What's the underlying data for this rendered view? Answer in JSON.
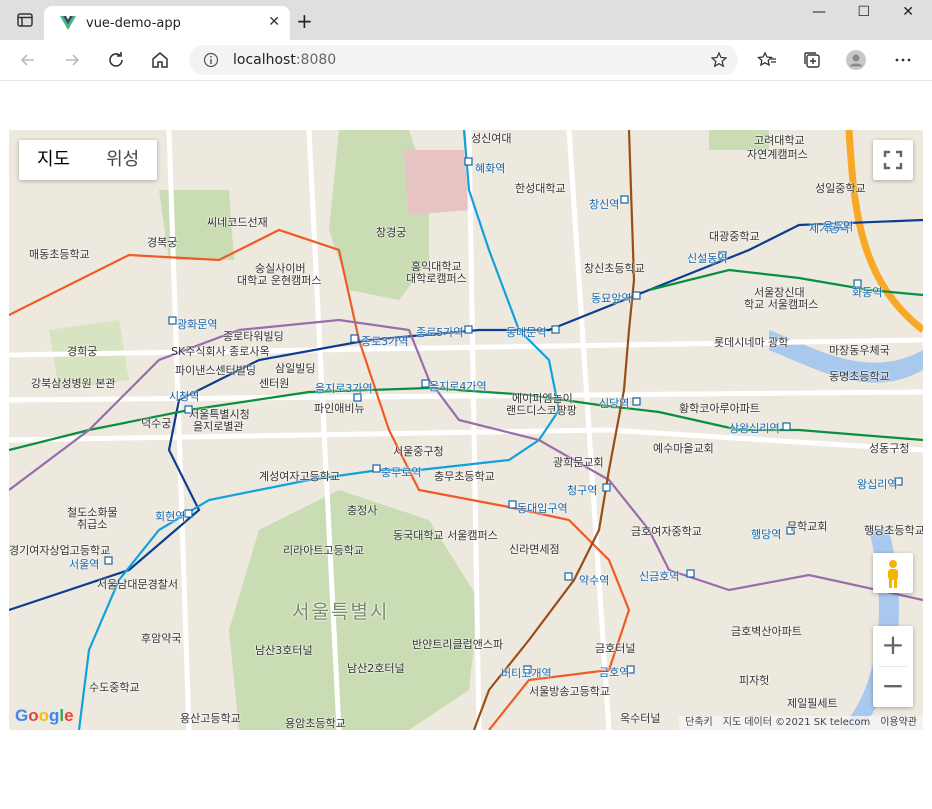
{
  "browser": {
    "tab_title": "vue-demo-app",
    "tab_close": "✕",
    "new_tab": "+",
    "address": "localhost",
    "address_port": ":8080",
    "minimize": "—",
    "maximize": "☐",
    "close": "✕"
  },
  "map": {
    "type_map": "지도",
    "type_satellite": "위성",
    "zoom_in": "+",
    "zoom_out": "−",
    "google_logo": "Google",
    "attribution": [
      "단축키",
      "지도 데이터 ©2021 SK telecom",
      "이용약관"
    ],
    "labels": [
      {
        "t": "성신여대",
        "c": "lbl"
      },
      {
        "t": "고려대학교",
        "c": "lbl"
      },
      {
        "t": "자연계캠퍼스",
        "c": "lbl"
      },
      {
        "t": "혜화역",
        "c": "lbl station"
      },
      {
        "t": "한성대학교",
        "c": "lbl"
      },
      {
        "t": "창신역",
        "c": "lbl station"
      },
      {
        "t": "경복궁",
        "c": "lbl"
      },
      {
        "t": "창경궁",
        "c": "lbl"
      },
      {
        "t": "씨네코드선재",
        "c": "lbl"
      },
      {
        "t": "매동초등학교",
        "c": "lbl"
      },
      {
        "t": "숭실사이버",
        "c": "lbl"
      },
      {
        "t": "대학교 운현캠퍼스",
        "c": "lbl"
      },
      {
        "t": "홍익대학교",
        "c": "lbl"
      },
      {
        "t": "대학로캠퍼스",
        "c": "lbl"
      },
      {
        "t": "창신초등학교",
        "c": "lbl"
      },
      {
        "t": "대광중학교",
        "c": "lbl"
      },
      {
        "t": "신설동역",
        "c": "lbl station"
      },
      {
        "t": "제기동역",
        "c": "lbl station"
      },
      {
        "t": "동묘앞역",
        "c": "lbl station"
      },
      {
        "t": "서울장신대",
        "c": "lbl"
      },
      {
        "t": "학교 서울캠퍼스",
        "c": "lbl"
      },
      {
        "t": "광화문역",
        "c": "lbl station"
      },
      {
        "t": "종로타워빌딩",
        "c": "lbl"
      },
      {
        "t": "종로3가역",
        "c": "lbl station"
      },
      {
        "t": "종로5가역",
        "c": "lbl station"
      },
      {
        "t": "동대문역",
        "c": "lbl station"
      },
      {
        "t": "롯데시네마 광학",
        "c": "lbl"
      },
      {
        "t": "경희궁",
        "c": "lbl"
      },
      {
        "t": "SK주식회사 종로사옥",
        "c": "lbl"
      },
      {
        "t": "삼일빌딩",
        "c": "lbl"
      },
      {
        "t": "파이낸스센터빌딩",
        "c": "lbl"
      },
      {
        "t": "센터원",
        "c": "lbl"
      },
      {
        "t": "을지로3가역",
        "c": "lbl station"
      },
      {
        "t": "을지로4가역",
        "c": "lbl station"
      },
      {
        "t": "에이피엠놀이",
        "c": "lbl"
      },
      {
        "t": "랜드디스코팡팡",
        "c": "lbl"
      },
      {
        "t": "강북삼성병원 본관",
        "c": "lbl"
      },
      {
        "t": "시청역",
        "c": "lbl station"
      },
      {
        "t": "서울특별시청",
        "c": "lbl"
      },
      {
        "t": "을지로별관",
        "c": "lbl"
      },
      {
        "t": "파인애비뉴",
        "c": "lbl"
      },
      {
        "t": "신당역",
        "c": "lbl station"
      },
      {
        "t": "황학코아루아파트",
        "c": "lbl"
      },
      {
        "t": "상왕십리역",
        "c": "lbl station"
      },
      {
        "t": "덕수궁",
        "c": "lbl"
      },
      {
        "t": "서울중구청",
        "c": "lbl"
      },
      {
        "t": "예수마을교회",
        "c": "lbl"
      },
      {
        "t": "광희문교회",
        "c": "lbl"
      },
      {
        "t": "계성여자고등학교",
        "c": "lbl"
      },
      {
        "t": "충무로역",
        "c": "lbl station"
      },
      {
        "t": "충무초등학교",
        "c": "lbl"
      },
      {
        "t": "청구역",
        "c": "lbl station"
      },
      {
        "t": "왕십리역",
        "c": "lbl station"
      },
      {
        "t": "철도소화물",
        "c": "lbl"
      },
      {
        "t": "취급소",
        "c": "lbl"
      },
      {
        "t": "회현역",
        "c": "lbl station"
      },
      {
        "t": "충정사",
        "c": "lbl"
      },
      {
        "t": "동대입구역",
        "c": "lbl station"
      },
      {
        "t": "동국대학교 서울캠퍼스",
        "c": "lbl"
      },
      {
        "t": "금호여자중학교",
        "c": "lbl"
      },
      {
        "t": "행당역",
        "c": "lbl station"
      },
      {
        "t": "경기여자상업고등학교",
        "c": "lbl"
      },
      {
        "t": "서울역",
        "c": "lbl station"
      },
      {
        "t": "리라아트고등학교",
        "c": "lbl"
      },
      {
        "t": "신라면세점",
        "c": "lbl"
      },
      {
        "t": "약수역",
        "c": "lbl station"
      },
      {
        "t": "신금호역",
        "c": "lbl station"
      },
      {
        "t": "서울남대문경찰서",
        "c": "lbl"
      },
      {
        "t": "서울특별시",
        "c": "lbl big"
      },
      {
        "t": "금호벽산아파트",
        "c": "lbl"
      },
      {
        "t": "후암약국",
        "c": "lbl"
      },
      {
        "t": "남산3호터널",
        "c": "lbl"
      },
      {
        "t": "반얀트리클럽앤스파",
        "c": "lbl"
      },
      {
        "t": "금호터널",
        "c": "lbl"
      },
      {
        "t": "남산2호터널",
        "c": "lbl"
      },
      {
        "t": "버티고개역",
        "c": "lbl station"
      },
      {
        "t": "금호역",
        "c": "lbl station"
      },
      {
        "t": "수도중학교",
        "c": "lbl"
      },
      {
        "t": "서울방송고등학교",
        "c": "lbl"
      },
      {
        "t": "피자헛",
        "c": "lbl"
      },
      {
        "t": "제일필세트",
        "c": "lbl"
      },
      {
        "t": "용산고등학교",
        "c": "lbl"
      },
      {
        "t": "용암초등학교",
        "c": "lbl"
      },
      {
        "t": "옥수터널",
        "c": "lbl"
      },
      {
        "t": "마장동우체국",
        "c": "lbl"
      },
      {
        "t": "동명초등학교",
        "c": "lbl"
      },
      {
        "t": "성동구청",
        "c": "lbl"
      },
      {
        "t": "무학교회",
        "c": "lbl"
      },
      {
        "t": "행당초등학교",
        "c": "lbl"
      },
      {
        "t": "성일중학교",
        "c": "lbl"
      },
      {
        "t": "용두역",
        "c": "lbl station"
      },
      {
        "t": "화동역",
        "c": "lbl station"
      }
    ]
  }
}
